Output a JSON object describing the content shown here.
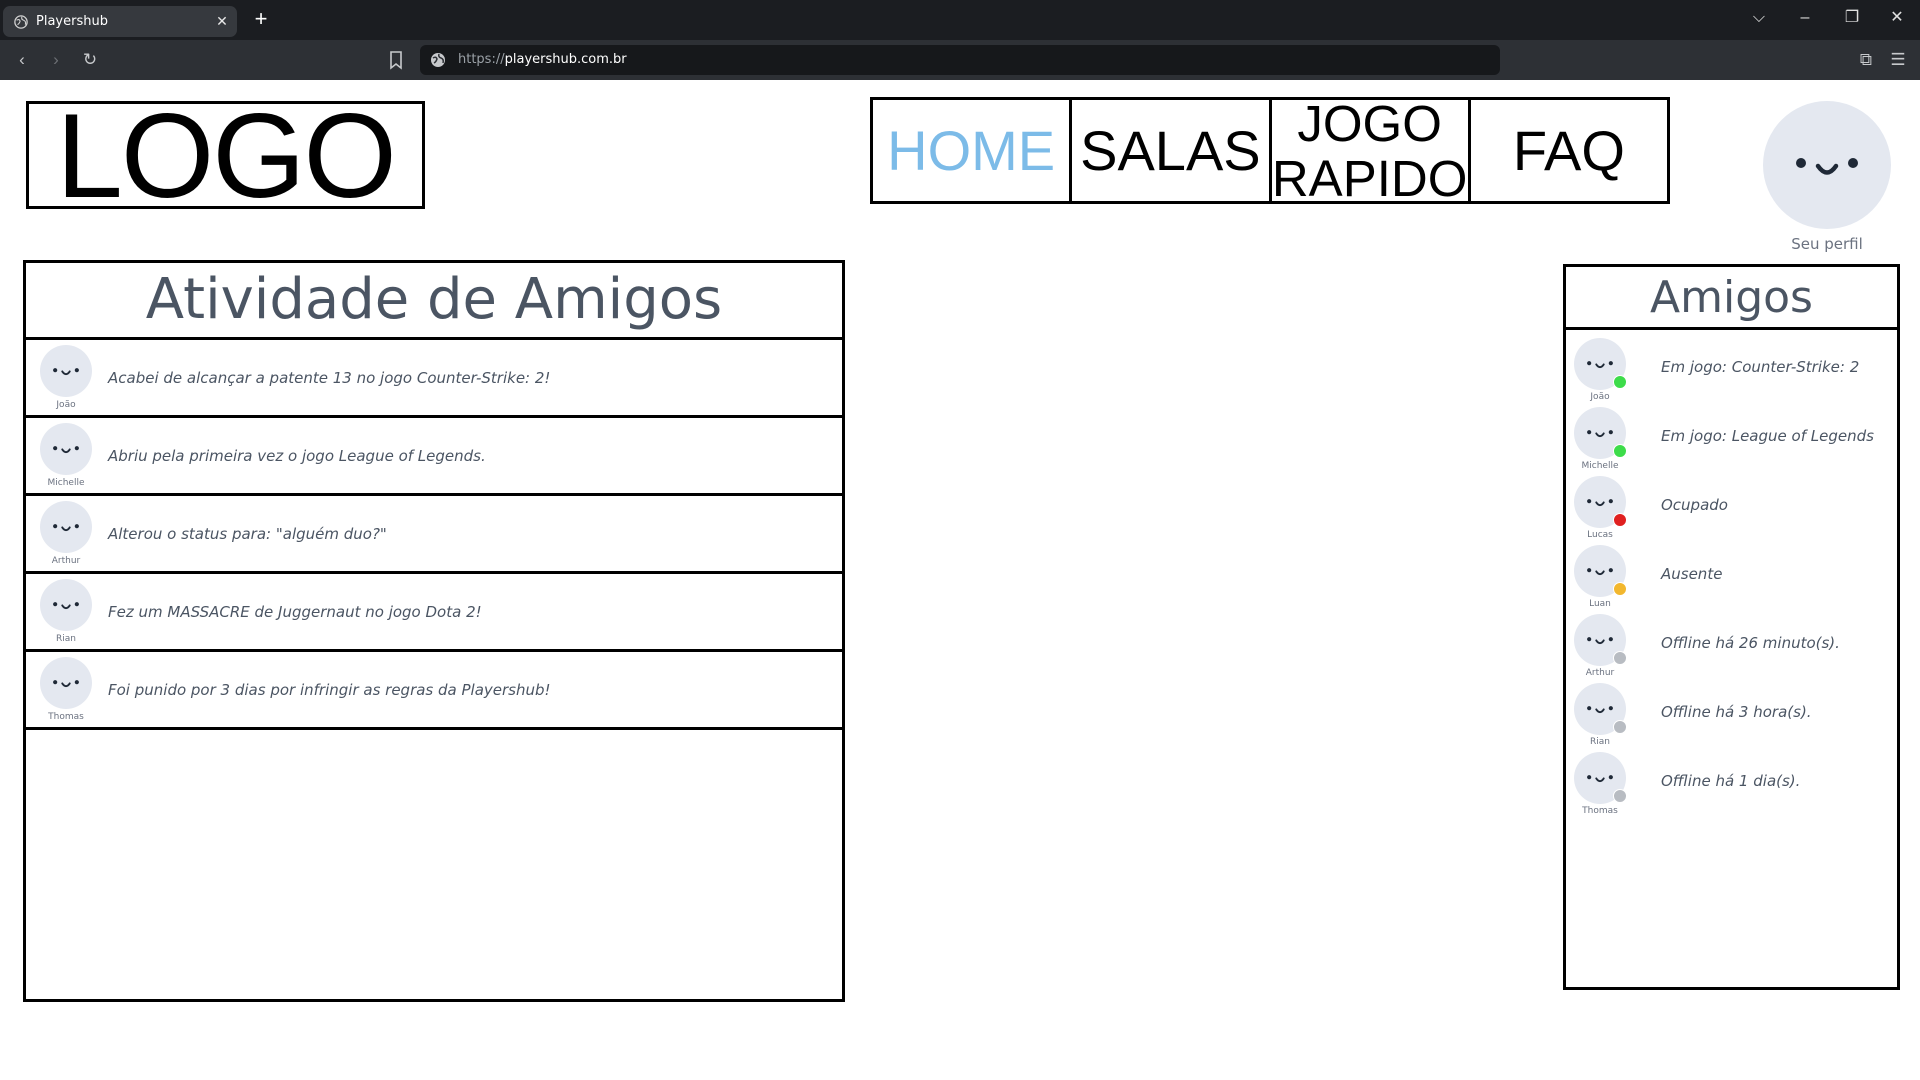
{
  "browser": {
    "tab_title": "Playershub",
    "tab_close": "✕",
    "new_tab": "+",
    "url_scheme": "https://",
    "url_host": "playershub.com.br"
  },
  "header": {
    "logo": "LOGO",
    "nav": [
      {
        "label": "HOME",
        "active": true
      },
      {
        "label": "SALAS",
        "active": false
      },
      {
        "label": "JOGO RAPIDO",
        "active": false
      },
      {
        "label": "FAQ",
        "active": false
      }
    ],
    "profile_caption": "Seu perfil"
  },
  "activity": {
    "title": "Atividade de Amigos",
    "items": [
      {
        "name": "João",
        "text": "Acabei de alcançar a patente 13 no jogo Counter-Strike: 2!"
      },
      {
        "name": "Michelle",
        "text": "Abriu pela primeira vez o jogo League of Legends."
      },
      {
        "name": "Arthur",
        "text": "Alterou o status para: \"alguém duo?\""
      },
      {
        "name": "Rian",
        "text": "Fez um MASSACRE de Juggernaut no jogo Dota 2!"
      },
      {
        "name": "Thomas",
        "text": "Foi punido por 3 dias por infringir as regras da Playershub!"
      }
    ]
  },
  "friends": {
    "title": "Amigos",
    "items": [
      {
        "name": "João",
        "status": "Em jogo: Counter-Strike: 2",
        "color": "#3ddc4a"
      },
      {
        "name": "Michelle",
        "status": "Em jogo: League of Legends",
        "color": "#3ddc4a"
      },
      {
        "name": "Lucas",
        "status": "Ocupado",
        "color": "#e02020"
      },
      {
        "name": "Luan",
        "status": "Ausente",
        "color": "#f2b72e"
      },
      {
        "name": "Arthur",
        "status": "Offline há 26 minuto(s).",
        "color": "#b8bcc2"
      },
      {
        "name": "Rian",
        "status": "Offline há 3 hora(s).",
        "color": "#b8bcc2"
      },
      {
        "name": "Thomas",
        "status": "Offline há 1 dia(s).",
        "color": "#b8bcc2"
      }
    ]
  }
}
